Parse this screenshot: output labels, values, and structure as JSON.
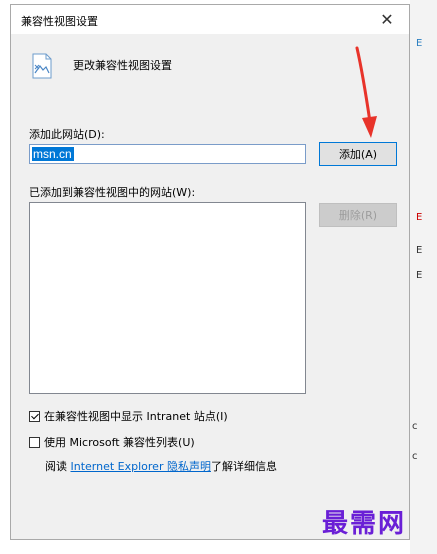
{
  "dialog": {
    "title": "兼容性视图设置",
    "close_glyph": "✕",
    "header_text": "更改兼容性视图设置"
  },
  "add_site": {
    "label": "添加此网站(D):",
    "input_value": "msn.cn",
    "add_button": "添加(A)"
  },
  "site_list": {
    "label": "已添加到兼容性视图中的网站(W):",
    "items": [],
    "remove_button": "删除(R)"
  },
  "options": {
    "intranet": {
      "label": "在兼容性视图中显示 Intranet 站点(I)",
      "checked": true
    },
    "ms_list": {
      "label": "使用 Microsoft 兼容性列表(U)",
      "checked": false
    }
  },
  "footer": {
    "prefix": "阅读 ",
    "link": "Internet Explorer 隐私声明",
    "suffix": "了解详细信息"
  },
  "background": {
    "fragments": [
      "E",
      "E",
      "c",
      "c",
      "E",
      "E"
    ]
  },
  "watermark": "最需网",
  "colors": {
    "accent": "#0078d7",
    "arrow": "#e8332a",
    "watermark": "#6a1fd6"
  }
}
